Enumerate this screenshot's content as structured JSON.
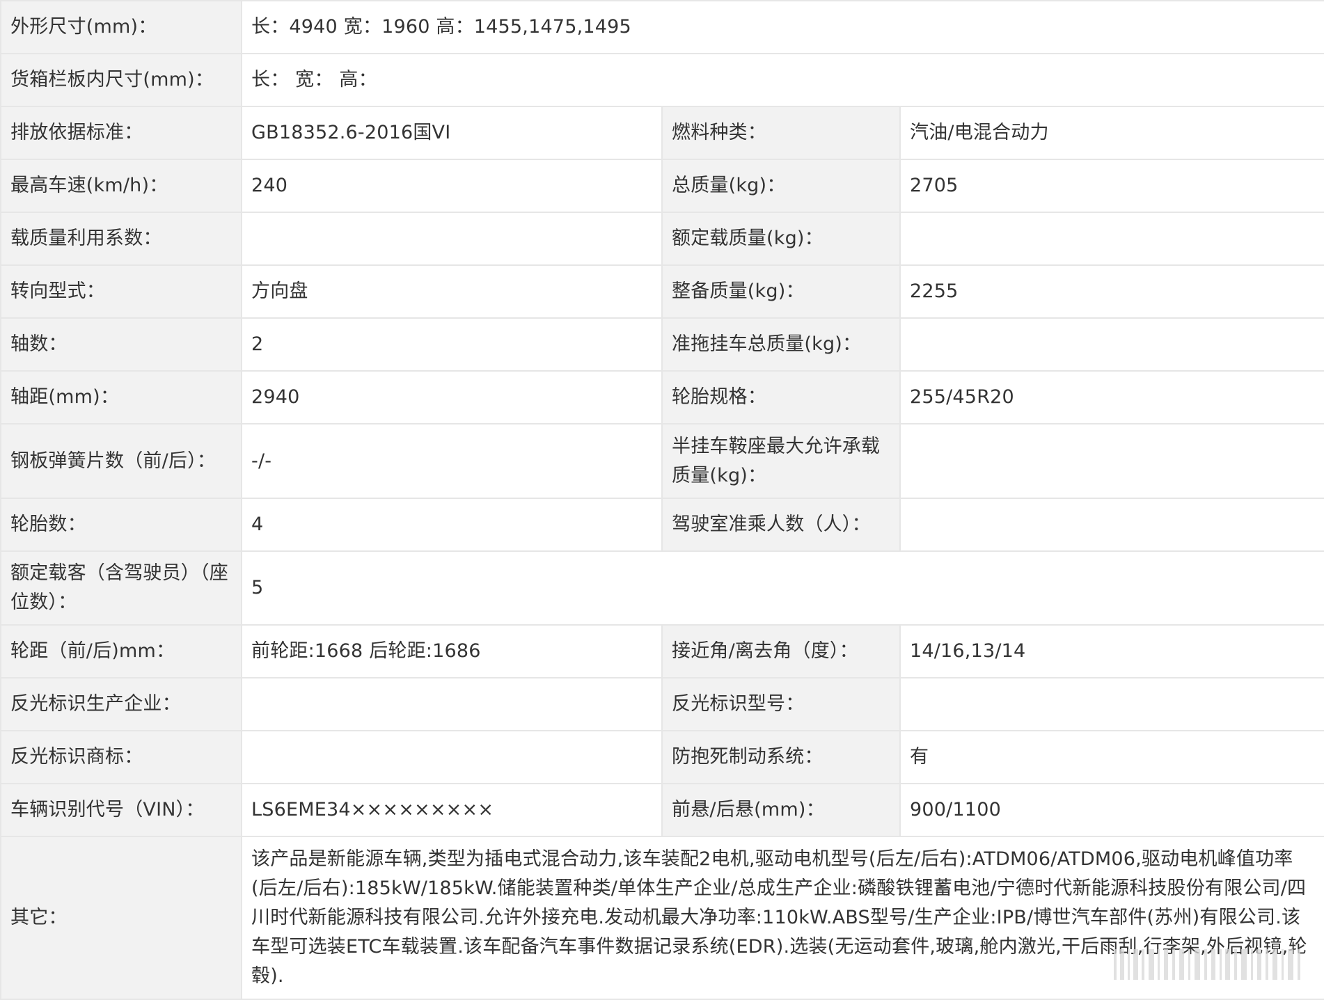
{
  "rows": [
    {
      "label": "外形尺寸(mm)：",
      "value": "长：4940 宽：1960 高：1455,1475,1495"
    },
    {
      "label": "货箱栏板内尺寸(mm)：",
      "value": "长：  宽：  高："
    },
    {
      "label": "排放依据标准：",
      "value": "GB18352.6-2016国VI",
      "label2": "燃料种类：",
      "value2": "汽油/电混合动力"
    },
    {
      "label": "最高车速(km/h)：",
      "value": "240",
      "label2": "总质量(kg)：",
      "value2": "2705"
    },
    {
      "label": "载质量利用系数：",
      "value": "",
      "label2": "额定载质量(kg)：",
      "value2": ""
    },
    {
      "label": "转向型式：",
      "value": "方向盘",
      "label2": "整备质量(kg)：",
      "value2": "2255"
    },
    {
      "label": "轴数：",
      "value": "2",
      "label2": "准拖挂车总质量(kg)：",
      "value2": ""
    },
    {
      "label": "轴距(mm)：",
      "value": "2940",
      "label2": "轮胎规格：",
      "value2": "255/45R20"
    },
    {
      "label": "钢板弹簧片数（前/后）：",
      "value": "-/-",
      "label2": "半挂车鞍座最大允许承载质量(kg)：",
      "value2": ""
    },
    {
      "label": "轮胎数：",
      "value": "4",
      "label2": "驾驶室准乘人数（人）：",
      "value2": ""
    },
    {
      "label": "额定载客（含驾驶员）（座位数）：",
      "value": "5"
    },
    {
      "label": "轮距（前/后)mm：",
      "value": "前轮距:1668 后轮距:1686",
      "label2": "接近角/离去角（度）：",
      "value2": "14/16,13/14"
    },
    {
      "label": "反光标识生产企业：",
      "value": "",
      "label2": "反光标识型号：",
      "value2": ""
    },
    {
      "label": "反光标识商标：",
      "value": "",
      "label2": "防抱死制动系统：",
      "value2": "有"
    },
    {
      "label": "车辆识别代号（VIN）：",
      "value": "LS6EME34×××××××××",
      "label2": "前悬/后悬(mm)：",
      "value2": "900/1100"
    },
    {
      "label": "其它：",
      "value": "该产品是新能源车辆,类型为插电式混合动力,该车装配2电机,驱动电机型号(后左/后右):ATDM06/ATDM06,驱动电机峰值功率(后左/后右):185kW/185kW.储能装置种类/单体生产企业/总成生产企业:磷酸铁锂蓄电池/宁德时代新能源科技股份有限公司/四川时代新能源科技有限公司.允许外接充电.发动机最大净功率:110kW.ABS型号/生产企业:IPB/博世汽车部件(苏州)有限公司.该车型可选装ETC车载装置.该车配备汽车事件数据记录系统(EDR).选装(无运动套件,玻璃,舱内激光,干后雨刮,行李架,外后视镜,轮毂)."
    }
  ]
}
